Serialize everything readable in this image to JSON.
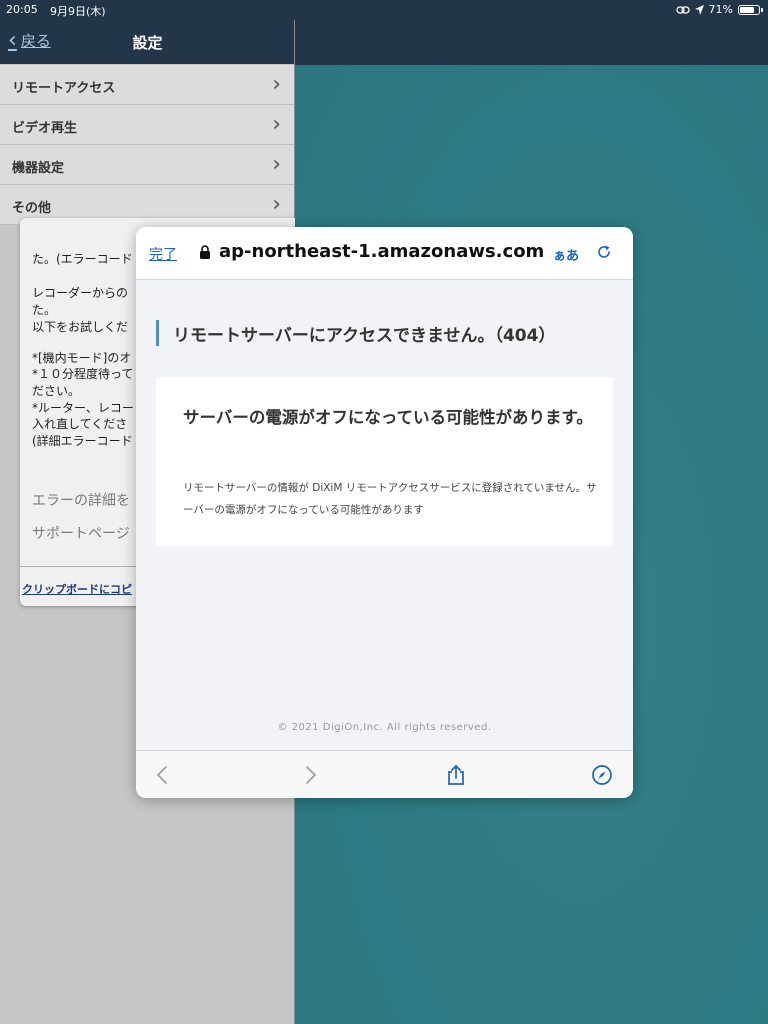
{
  "status_bar": {
    "time": "20:05",
    "date": "9月9日(木)",
    "battery": "71%"
  },
  "nav": {
    "back_label": "戻る",
    "title": "設定"
  },
  "settings_items": [
    {
      "label": "リモートアクセス"
    },
    {
      "label": "ビデオ再生"
    },
    {
      "label": "機器設定"
    },
    {
      "label": "その他"
    }
  ],
  "error_card": {
    "lines": [
      "た。(エラーコード",
      "レコーダーからの",
      "た。",
      "以下をお試しくだ",
      "*[機内モード]のオ",
      "*１０分程度待って",
      "ださい。",
      "*ルーター、レコー",
      "入れ直してくださ",
      "(詳細エラーコード"
    ],
    "details_label": "エラーの詳細を",
    "support_label": "サポートページ",
    "copy_label": "クリップボードにコピ"
  },
  "browser": {
    "done_label": "完了",
    "url": "ap-northeast-1.amazonaws.com",
    "text_size_label": "ぁあ"
  },
  "page": {
    "heading": "リモートサーバーにアクセスできません。（404）",
    "card_title": "サーバーの電源がオフになっている可能性があります。",
    "card_body": "リモートサーバーの情報が DiXiM リモートアクセスサービスに登録されていません。サーバーの電源がオフになっている可能性があります",
    "copyright": "© 2021 DigiOn,Inc. All rights reserved."
  },
  "colors": {
    "nav_bar": "#233548",
    "teal_bg": "#2c7a83",
    "link_blue": "#1b63c4",
    "heading_accent": "#4a90d9"
  },
  "icons": [
    "back-chevron-icon",
    "chevron-right-icon",
    "lock-icon",
    "reload-icon",
    "back-arrow-icon",
    "forward-arrow-icon",
    "share-icon",
    "safari-compass-icon",
    "link-icon",
    "location-icon",
    "battery-icon"
  ]
}
